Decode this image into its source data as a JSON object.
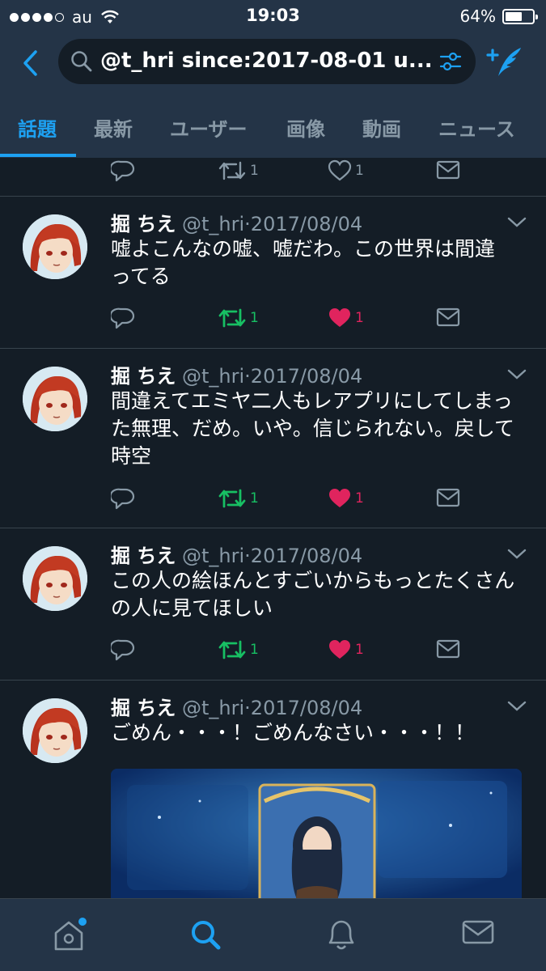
{
  "status_bar": {
    "carrier": "au",
    "time": "19:03",
    "battery": "64%",
    "battery_level": 0.64
  },
  "search": {
    "query": "@t_hri since:2017-08-01  u..."
  },
  "tabs": [
    {
      "label": "話題",
      "active": true
    },
    {
      "label": "最新",
      "active": false
    },
    {
      "label": "ユーザー",
      "active": false
    },
    {
      "label": "画像",
      "active": false
    },
    {
      "label": "動画",
      "active": false
    },
    {
      "label": "ニュース",
      "active": false
    }
  ],
  "top_actions": {
    "retweets": "1",
    "likes": "1"
  },
  "tweets": [
    {
      "name": "掘 ちえ",
      "handle": "@t_hri",
      "date": "2017/08/04",
      "text": "嘘よこんなの嘘、嘘だわ。この世界は間違ってる",
      "retweets": "1",
      "likes": "1"
    },
    {
      "name": "掘 ちえ",
      "handle": "@t_hri",
      "date": "2017/08/04",
      "text": "間違えてエミヤ二人もレアプリにしてしまった無理、だめ。いや。信じられない。戻して時空",
      "retweets": "1",
      "likes": "1"
    },
    {
      "name": "掘 ちえ",
      "handle": "@t_hri",
      "date": "2017/08/04",
      "text": "この人の絵ほんとすごいからもっとたくさんの人に見てほしい",
      "retweets": "1",
      "likes": "1"
    },
    {
      "name": "掘 ちえ",
      "handle": "@t_hri",
      "date": "2017/08/04",
      "text": "ごめん・・・！ごめんなさい・・・！！"
    }
  ],
  "colors": {
    "background": "#141d26",
    "header": "#243447",
    "accent": "#1da1f2",
    "retweet_active": "#17bf63",
    "like_active": "#e0245e",
    "muted": "#8899a6"
  },
  "icons": [
    "search-icon",
    "filter-icon",
    "compose-icon",
    "reply-icon",
    "retweet-icon",
    "like-icon",
    "dm-icon",
    "home-icon",
    "notifications-icon",
    "messages-icon"
  ]
}
